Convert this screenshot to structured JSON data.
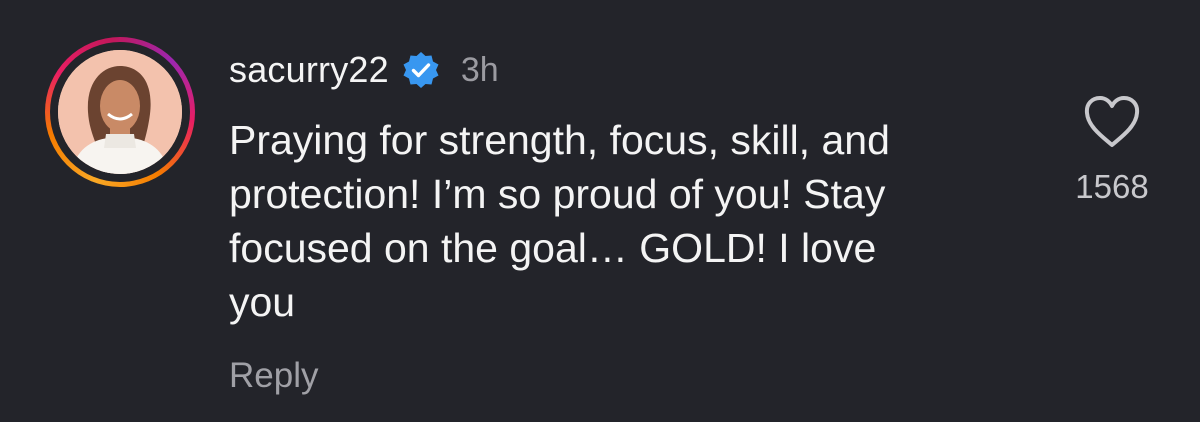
{
  "comment": {
    "username": "sacurry22",
    "verified": true,
    "time": "3h",
    "text_lines": [
      "Praying for strength, focus, skill, and",
      "protection! I’m so proud of you! Stay",
      "focused on the goal… GOLD! I love",
      "you"
    ],
    "reply_label": "Reply",
    "like_count": "1568",
    "like_icon": "heart-icon",
    "verified_icon": "verified-badge-icon",
    "avatar_icon": "user-avatar"
  },
  "colors": {
    "background": "#23242a",
    "text": "#f4f4f4",
    "muted": "#9b9ba1",
    "verified": "#3897f0"
  }
}
